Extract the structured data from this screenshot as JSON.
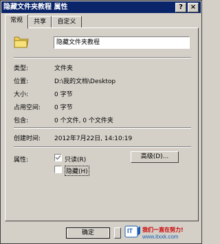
{
  "window": {
    "title": "隐藏文件夹教程 属性",
    "help_button": "?",
    "close_button": "×"
  },
  "tabs": [
    {
      "label": "常规",
      "active": true
    },
    {
      "label": "共享",
      "active": false
    },
    {
      "label": "自定义",
      "active": false
    }
  ],
  "general": {
    "folder_name": "隐藏文件夹教程",
    "rows": [
      {
        "label": "类型:",
        "value": "文件夹"
      },
      {
        "label": "位置:",
        "value": "D:\\我的文档\\Desktop"
      },
      {
        "label": "大小:",
        "value": "0 字节"
      },
      {
        "label": "占用空间:",
        "value": "0 字节"
      },
      {
        "label": "包含:",
        "value": "0 个文件, 0 个文件夹"
      }
    ],
    "created_label": "创建时间:",
    "created_value": "2012年7月22日, 14:10:19",
    "attributes_label": "属性:",
    "readonly_label": "只读(R)",
    "readonly_checked": true,
    "hidden_label": "隐藏(H)",
    "hidden_checked": false,
    "advanced_button": "高级(D)..."
  },
  "footer": {
    "ok_button": "确定"
  },
  "watermark": {
    "logo_text": "IT",
    "slogan": "我们一直在努力!",
    "url": "www.itxxk.com"
  },
  "colors": {
    "titlebar": "#0a246a",
    "face": "#d4d0c8",
    "watermark_red": "#cc0000",
    "watermark_blue": "#1a5fb4"
  }
}
